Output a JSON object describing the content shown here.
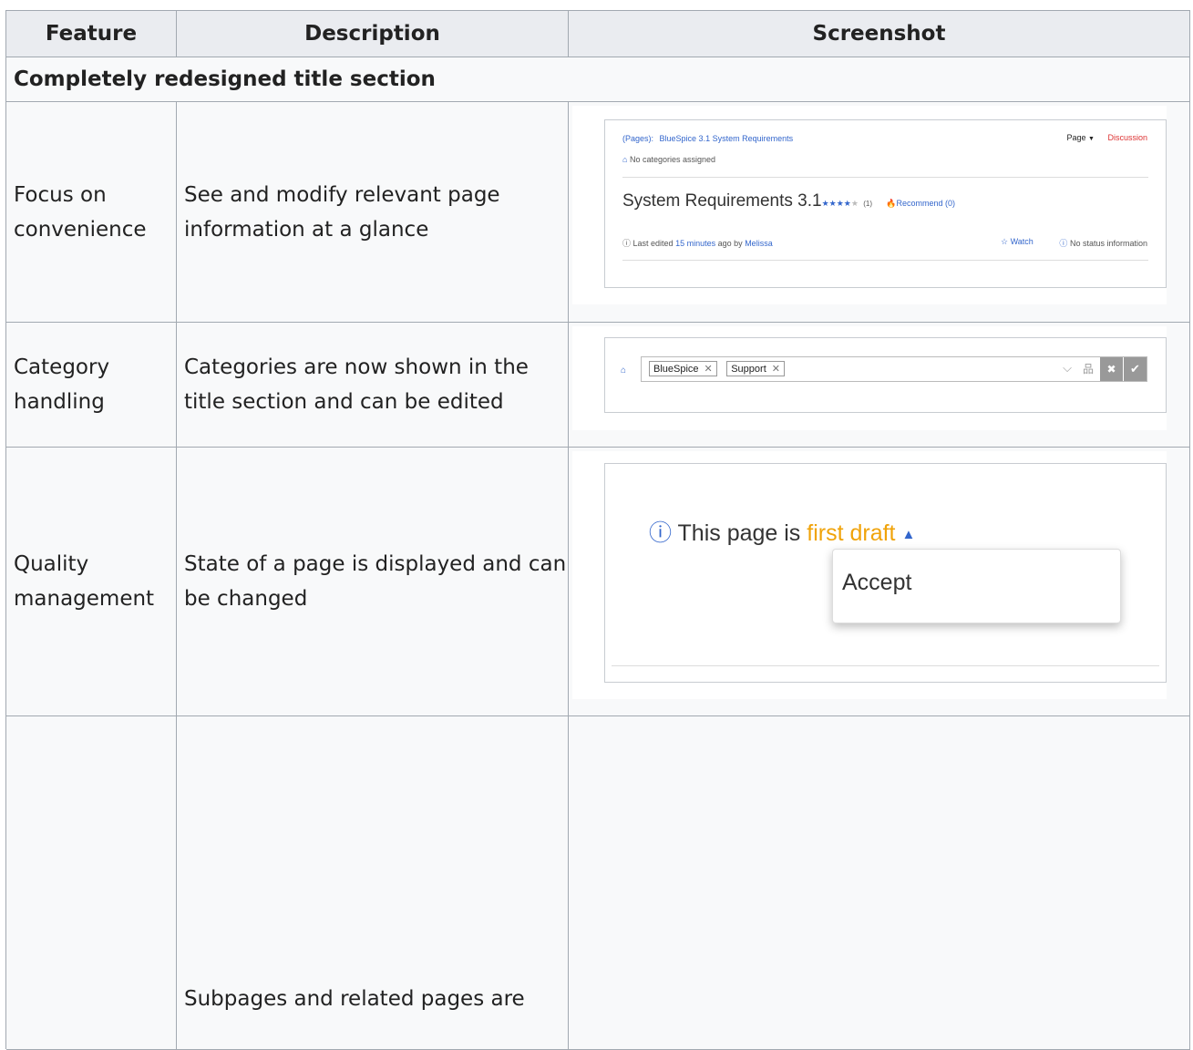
{
  "table": {
    "headers": [
      "Feature",
      "Description",
      "Screenshot"
    ],
    "section_title": "Completely redesigned title section",
    "rows": [
      {
        "feature": "Focus on convenience",
        "description": "See and modify relevant page information at a glance"
      },
      {
        "feature": "Category handling",
        "description": "Categories are now shown in the title section and can be edited"
      },
      {
        "feature": "Quality management",
        "description": "State of a page is displayed and can be changed"
      },
      {
        "feature": "",
        "description": "Subpages and related pages are"
      }
    ]
  },
  "shot1": {
    "breadcrumb_prefix": "(Pages):",
    "breadcrumb_page": "BlueSpice 3.1 System Requirements",
    "page_menu": "Page",
    "discussion": "Discussion",
    "no_categories": "No categories assigned",
    "title": "System Requirements 3.1",
    "stars": "★★★★",
    "star_empty": "★",
    "rating_count": "(1)",
    "recommend": "Recommend (0)",
    "last_edited_prefix": "Last edited",
    "last_edited_time": "15 minutes",
    "last_edited_mid": "ago by",
    "last_edited_user": "Melissa",
    "watch": "Watch",
    "status": "No status information"
  },
  "shot2": {
    "categories": [
      "BlueSpice",
      "Support"
    ]
  },
  "shot3": {
    "status_prefix": "This page is",
    "status_value": "first draft",
    "menu_item": "Accept"
  },
  "colors": {
    "link": "#3366cc",
    "discussion": "#d33",
    "draft": "#f0a30a",
    "info_icon": "#3366cc"
  }
}
